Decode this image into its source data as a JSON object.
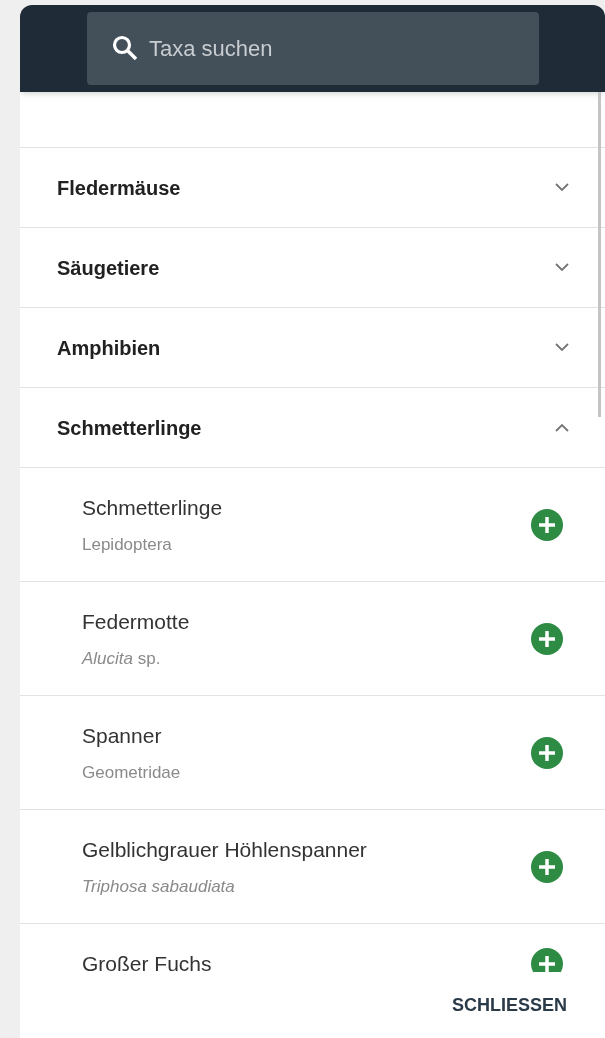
{
  "search": {
    "placeholder": "Taxa suchen"
  },
  "categories": [
    {
      "label": "Fledermäuse",
      "expanded": false
    },
    {
      "label": "Säugetiere",
      "expanded": false
    },
    {
      "label": "Amphibien",
      "expanded": false
    },
    {
      "label": "Schmetterlinge",
      "expanded": true,
      "children": [
        {
          "name": "Schmetterlinge",
          "scientific": "Lepidoptera",
          "italic": false
        },
        {
          "name": "Federmotte",
          "scientific": "*Alucita* sp.",
          "italic": false
        },
        {
          "name": "Spanner",
          "scientific": "Geometridae",
          "italic": false
        },
        {
          "name": "Gelblichgrauer Höhlenspanner",
          "scientific": "Triphosa sabaudiata",
          "italic": true
        },
        {
          "name": "Großer Fuchs"
        }
      ]
    }
  ],
  "footer": {
    "close_button": "SCHLIESSEN"
  }
}
